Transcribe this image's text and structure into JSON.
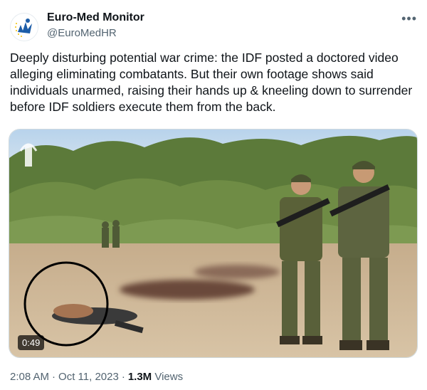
{
  "author": {
    "display_name": "Euro-Med Monitor",
    "handle": "@EuroMedHR",
    "avatar_icon": "euro-med-logo-icon",
    "brand_color": "#1d5da8"
  },
  "more_icon": "more-horizontal-icon",
  "tweet": {
    "text": "Deeply disturbing potential war crime: the IDF posted a doctored video alleging eliminating combatants. But their own footage shows said individuals unarmed, raising their hands up & kneeling down to surrender before IDF soldiers execute them from the back."
  },
  "media": {
    "type": "video",
    "duration": "0:49"
  },
  "meta": {
    "time": "2:08 AM",
    "date": "Oct 11, 2023",
    "views_count": "1.3M",
    "views_label": "Views"
  }
}
